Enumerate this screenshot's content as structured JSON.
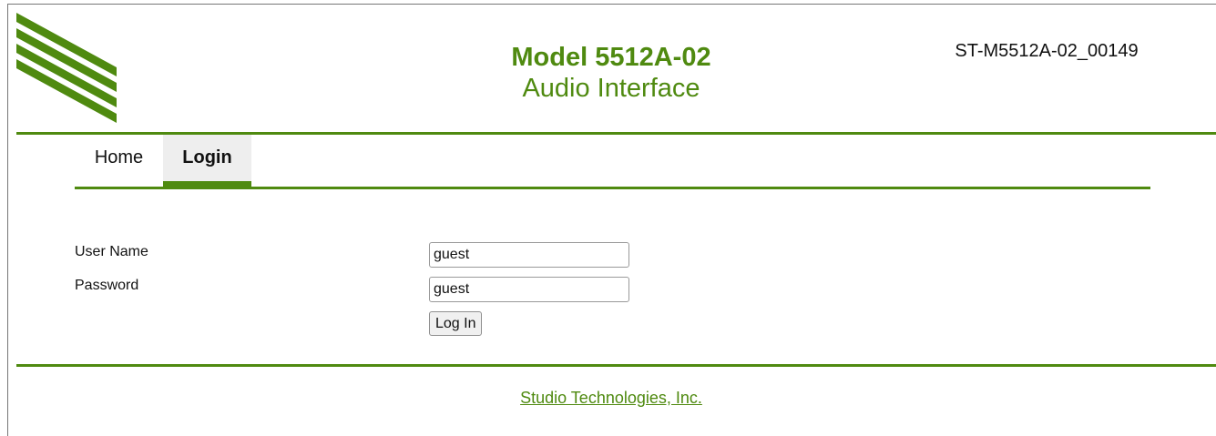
{
  "header": {
    "logo_icon": "diagonal-stripes-logo",
    "model_title": "Model 5512A-02",
    "model_subtitle": "Audio Interface",
    "device_id": "ST-M5512A-02_00149"
  },
  "nav": {
    "tabs": [
      {
        "label": "Home",
        "active": false
      },
      {
        "label": "Login",
        "active": true
      }
    ]
  },
  "login_form": {
    "username_label": "User Name",
    "username_value": "guest",
    "password_label": "Password",
    "password_value": "guest",
    "submit_label": "Log In"
  },
  "footer": {
    "link_text": "Studio Technologies, Inc."
  },
  "colors": {
    "accent": "#4f8a10",
    "active_tab_bg": "#eeeeee"
  }
}
